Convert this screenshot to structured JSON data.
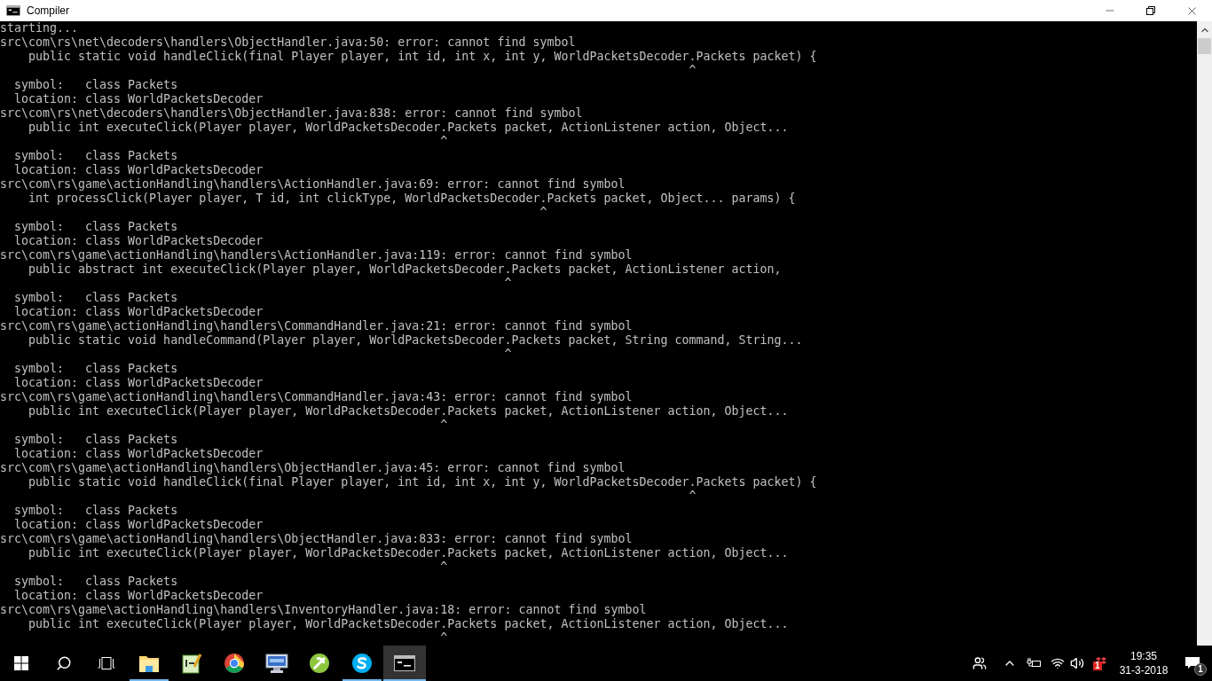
{
  "window": {
    "title": "Compiler"
  },
  "console": {
    "lines": [
      "starting...",
      "src\\com\\rs\\net\\decoders\\handlers\\ObjectHandler.java:50: error: cannot find symbol",
      "    public static void handleClick(final Player player, int id, int x, int y, WorldPacketsDecoder.Packets packet) {",
      "                                                                                                 ^",
      "  symbol:   class Packets",
      "  location: class WorldPacketsDecoder",
      "src\\com\\rs\\net\\decoders\\handlers\\ObjectHandler.java:838: error: cannot find symbol",
      "    public int executeClick(Player player, WorldPacketsDecoder.Packets packet, ActionListener action, Object...",
      "                                                              ^",
      "  symbol:   class Packets",
      "  location: class WorldPacketsDecoder",
      "src\\com\\rs\\game\\actionHandling\\handlers\\ActionHandler.java:69: error: cannot find symbol",
      "    int processClick(Player player, T id, int clickType, WorldPacketsDecoder.Packets packet, Object... params) {",
      "                                                                            ^",
      "  symbol:   class Packets",
      "  location: class WorldPacketsDecoder",
      "src\\com\\rs\\game\\actionHandling\\handlers\\ActionHandler.java:119: error: cannot find symbol",
      "    public abstract int executeClick(Player player, WorldPacketsDecoder.Packets packet, ActionListener action,",
      "                                                                       ^",
      "  symbol:   class Packets",
      "  location: class WorldPacketsDecoder",
      "src\\com\\rs\\game\\actionHandling\\handlers\\CommandHandler.java:21: error: cannot find symbol",
      "    public static void handleCommand(Player player, WorldPacketsDecoder.Packets packet, String command, String...",
      "                                                                       ^",
      "  symbol:   class Packets",
      "  location: class WorldPacketsDecoder",
      "src\\com\\rs\\game\\actionHandling\\handlers\\CommandHandler.java:43: error: cannot find symbol",
      "    public int executeClick(Player player, WorldPacketsDecoder.Packets packet, ActionListener action, Object...",
      "                                                              ^",
      "  symbol:   class Packets",
      "  location: class WorldPacketsDecoder",
      "src\\com\\rs\\game\\actionHandling\\handlers\\ObjectHandler.java:45: error: cannot find symbol",
      "    public static void handleClick(final Player player, int id, int x, int y, WorldPacketsDecoder.Packets packet) {",
      "                                                                                                 ^",
      "  symbol:   class Packets",
      "  location: class WorldPacketsDecoder",
      "src\\com\\rs\\game\\actionHandling\\handlers\\ObjectHandler.java:833: error: cannot find symbol",
      "    public int executeClick(Player player, WorldPacketsDecoder.Packets packet, ActionListener action, Object...",
      "                                                              ^",
      "  symbol:   class Packets",
      "  location: class WorldPacketsDecoder",
      "src\\com\\rs\\game\\actionHandling\\handlers\\InventoryHandler.java:18: error: cannot find symbol",
      "    public int executeClick(Player player, WorldPacketsDecoder.Packets packet, ActionListener action, Object...",
      "                                                              ^"
    ]
  },
  "taskbar": {
    "apps": [
      {
        "kind": "folder",
        "running": true,
        "selected": false
      },
      {
        "kind": "notepad",
        "running": false,
        "selected": false
      },
      {
        "kind": "chrome",
        "running": false,
        "selected": false
      },
      {
        "kind": "network",
        "running": false,
        "selected": false
      },
      {
        "kind": "green",
        "running": false,
        "selected": false
      },
      {
        "kind": "skype",
        "running": true,
        "selected": false
      },
      {
        "kind": "console",
        "running": true,
        "selected": true
      }
    ],
    "tray": {
      "app_badge": "1",
      "time": "19:35",
      "date": "31-3-2018",
      "notifications": "1"
    }
  }
}
